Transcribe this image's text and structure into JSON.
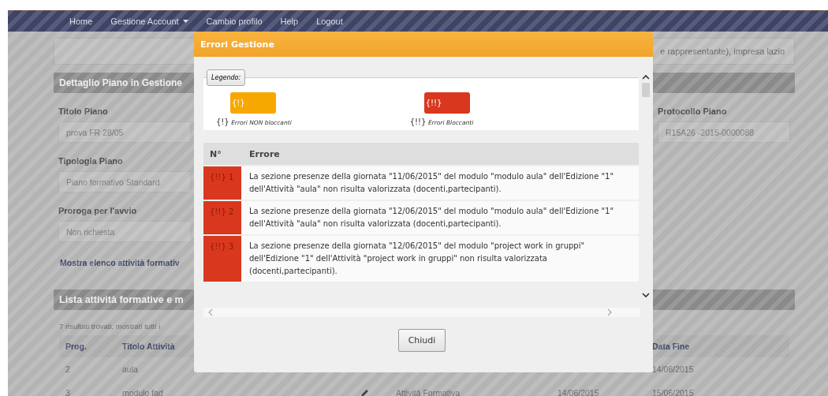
{
  "nav": {
    "items": [
      {
        "label": "Home",
        "caret": false
      },
      {
        "label": "Gestione Account",
        "caret": true
      },
      {
        "label": "Cambio profilo",
        "caret": false
      },
      {
        "label": "Help",
        "caret": false
      },
      {
        "label": "Logout",
        "caret": false
      }
    ]
  },
  "background": {
    "user_box": "e rappresentante), impresa lazio",
    "detail_header": "Dettaglio Piano in Gestione",
    "fields_left": [
      {
        "label": "Titolo Piano",
        "value": "prova FR 28/05"
      },
      {
        "label": "Tipologia Piano",
        "value": "Piano formativo Standard"
      },
      {
        "label": "Proroga per l'avvio",
        "value": "Non richiesta"
      }
    ],
    "fields_right": [
      {
        "label": "Protocollo Piano",
        "value": "R15A26 -2015-0000088"
      }
    ],
    "link": "Mostra elenco attività formativ",
    "list_header": "Lista attività formative e m",
    "results": "7 risultati trovati, mostrati tutti i",
    "table": {
      "columns": [
        "Prog.",
        "Titolo Attività",
        "Data Fine"
      ],
      "rows": [
        {
          "prog": "2",
          "title": "aula",
          "edit_icon": false,
          "type": "",
          "start": "",
          "end": "14/06/2015"
        },
        {
          "prog": "3",
          "title": "modulo fad",
          "edit_icon": true,
          "type": "Attività Formativa",
          "start": "14/06/2015",
          "end": "15/06/2015"
        }
      ]
    }
  },
  "modal": {
    "title": "Errori Gestione",
    "legend": {
      "label": "Legendo:",
      "items": [
        {
          "badge": "{!}",
          "marker": "{!}",
          "caption": "Errori NON bloccanti",
          "color": "#f7a800"
        },
        {
          "badge": "{!!}",
          "marker": "{!!}",
          "caption": "Errori Bloccanti",
          "color": "#d9381e"
        }
      ]
    },
    "columns": [
      "N°",
      "Errore"
    ],
    "errors": [
      {
        "code": "{!!} 1",
        "color": "#d9381e",
        "message": "La sezione presenze della giornata \"11/06/2015\" del modulo \"modulo aula\" dell'Edizione \"1\" dell'Attività \"aula\" non risulta valorizzata (docenti,partecipanti)."
      },
      {
        "code": "{!!} 2",
        "color": "#d9381e",
        "message": "La sezione presenze della giornata \"12/06/2015\" del modulo \"modulo aula\" dell'Edizione \"1\" dell'Attività \"aula\" non risulta valorizzata (docenti,partecipanti)."
      },
      {
        "code": "{!!} 3",
        "color": "#d9381e",
        "message": "La sezione presenze della giornata \"12/06/2015\" del modulo \"project work in gruppi\" dell'Edizione \"1\" dell'Attività \"project work in gruppi\" non risulta valorizzata (docenti,partecipanti)."
      }
    ],
    "close_button": "Chiudi"
  }
}
